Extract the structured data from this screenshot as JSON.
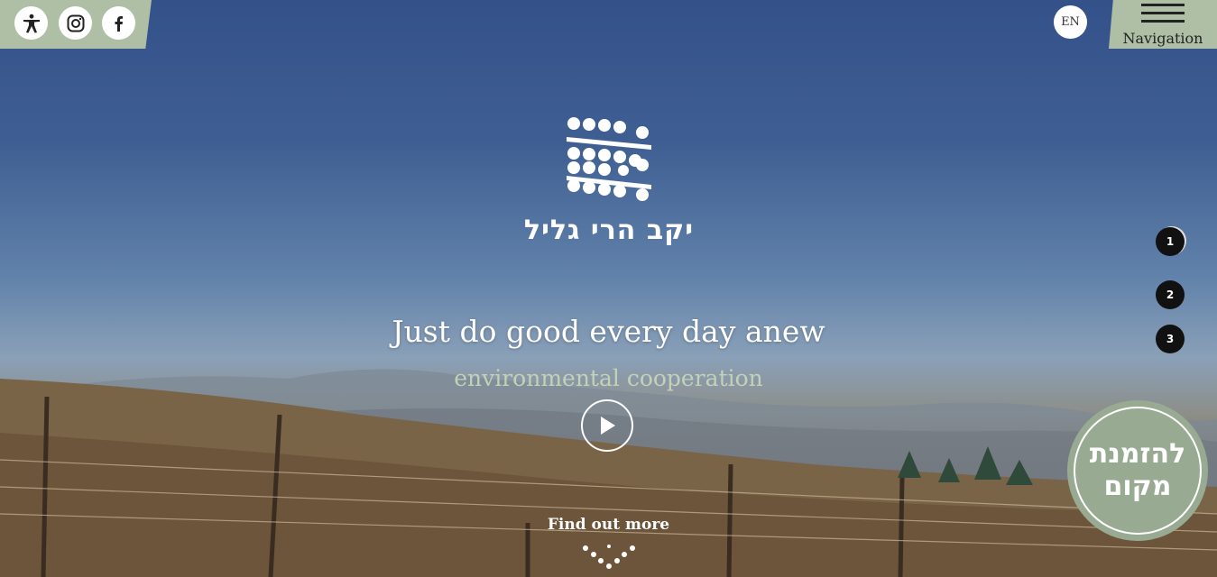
{
  "header": {
    "social": {
      "accessibility_icon": "accessibility-icon",
      "instagram_icon": "instagram-icon",
      "facebook_icon": "facebook-icon"
    },
    "language": "EN",
    "navigation_label": "Navigation"
  },
  "hero": {
    "logo_icon": "grape-cluster-logo-icon",
    "logo_text": "יקב הרי גליל",
    "headline": "Just do good every day anew",
    "subheadline": "environmental cooperation",
    "play_icon": "play-icon",
    "find_more": "Find out more",
    "scroll_icon": "dotted-chevron-down-icon"
  },
  "pager": {
    "items": [
      "1",
      "2",
      "3"
    ],
    "active": "1"
  },
  "reserve": {
    "line1": "להזמנת",
    "line2": "מקום"
  },
  "colors": {
    "tab_green": "#aebfa6",
    "badge_green": "#98ab92",
    "subheadline": "#c4d1b8",
    "pager_dot": "#111111"
  }
}
